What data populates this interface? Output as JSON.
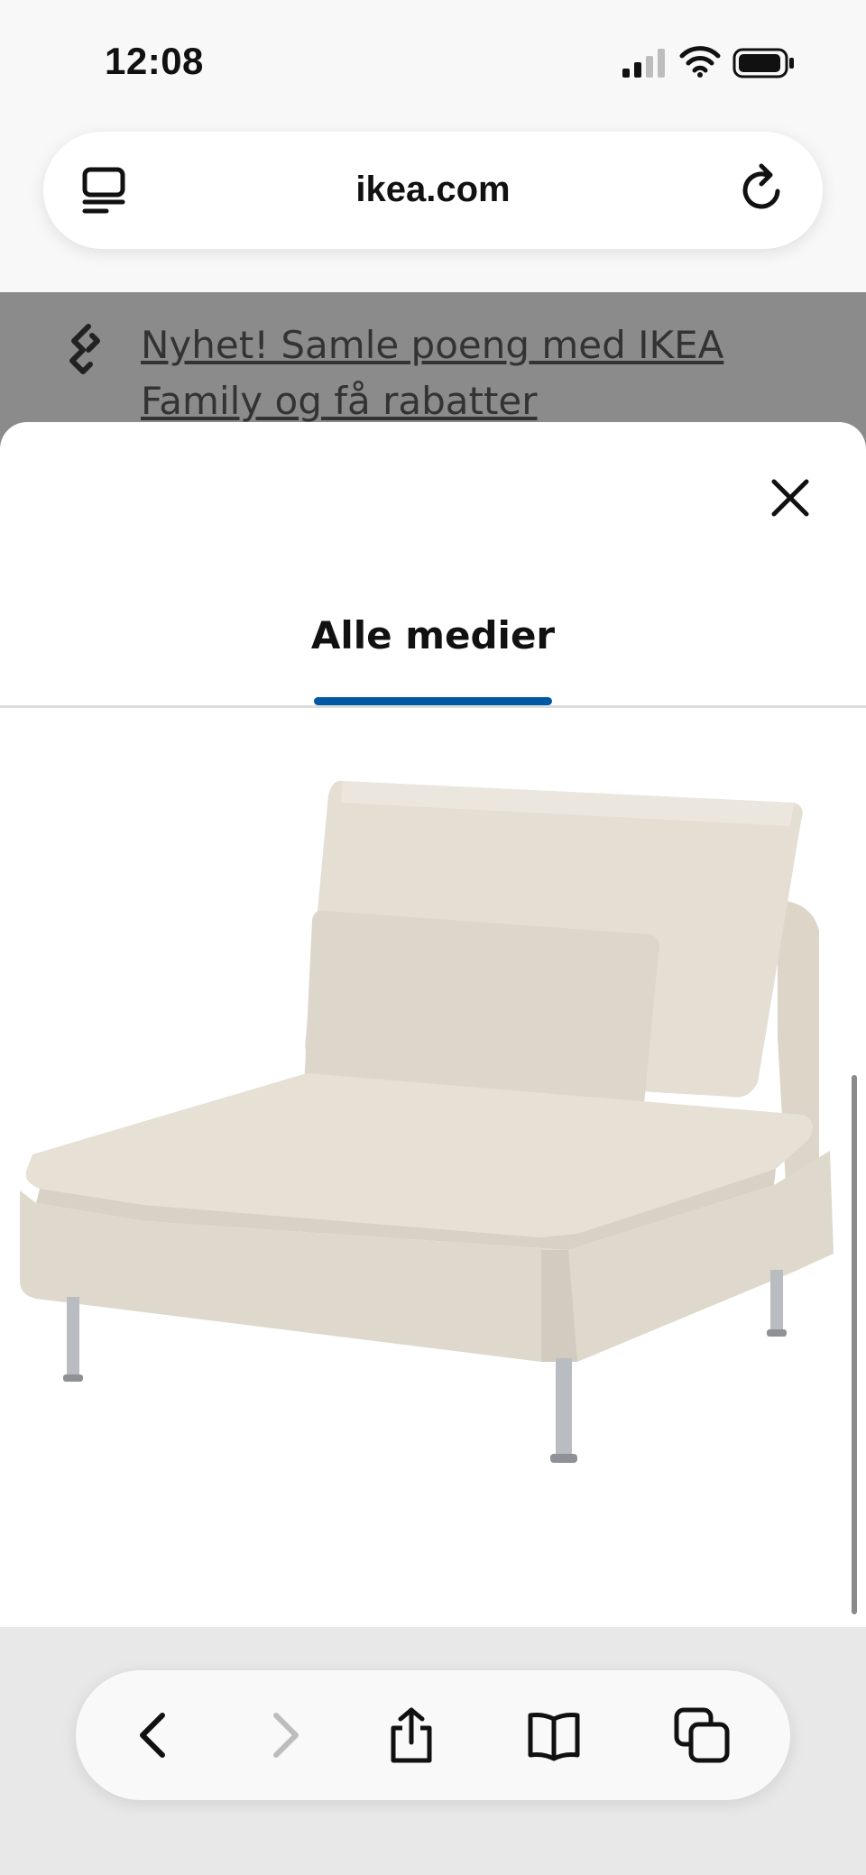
{
  "status_bar": {
    "time": "12:08",
    "icons": [
      "cellular-signal-icon",
      "wifi-icon",
      "battery-icon"
    ]
  },
  "browser": {
    "url": "ikea.com",
    "left_icon": "tabs-overview-icon",
    "right_icon": "reload-icon"
  },
  "promo_banner": {
    "text": "Nyhet! Samle poeng med IKEA Family og få rabatter",
    "icon": "link-icon"
  },
  "media_modal": {
    "close_icon": "close-icon",
    "tab_label": "Alle medier",
    "accent_color": "#0058a3",
    "image": "beige armchair sofa section product image"
  },
  "bottom_toolbar": {
    "items": [
      "back-icon",
      "forward-icon",
      "share-icon",
      "bookmarks-icon",
      "tabs-icon"
    ],
    "forward_disabled": true
  }
}
